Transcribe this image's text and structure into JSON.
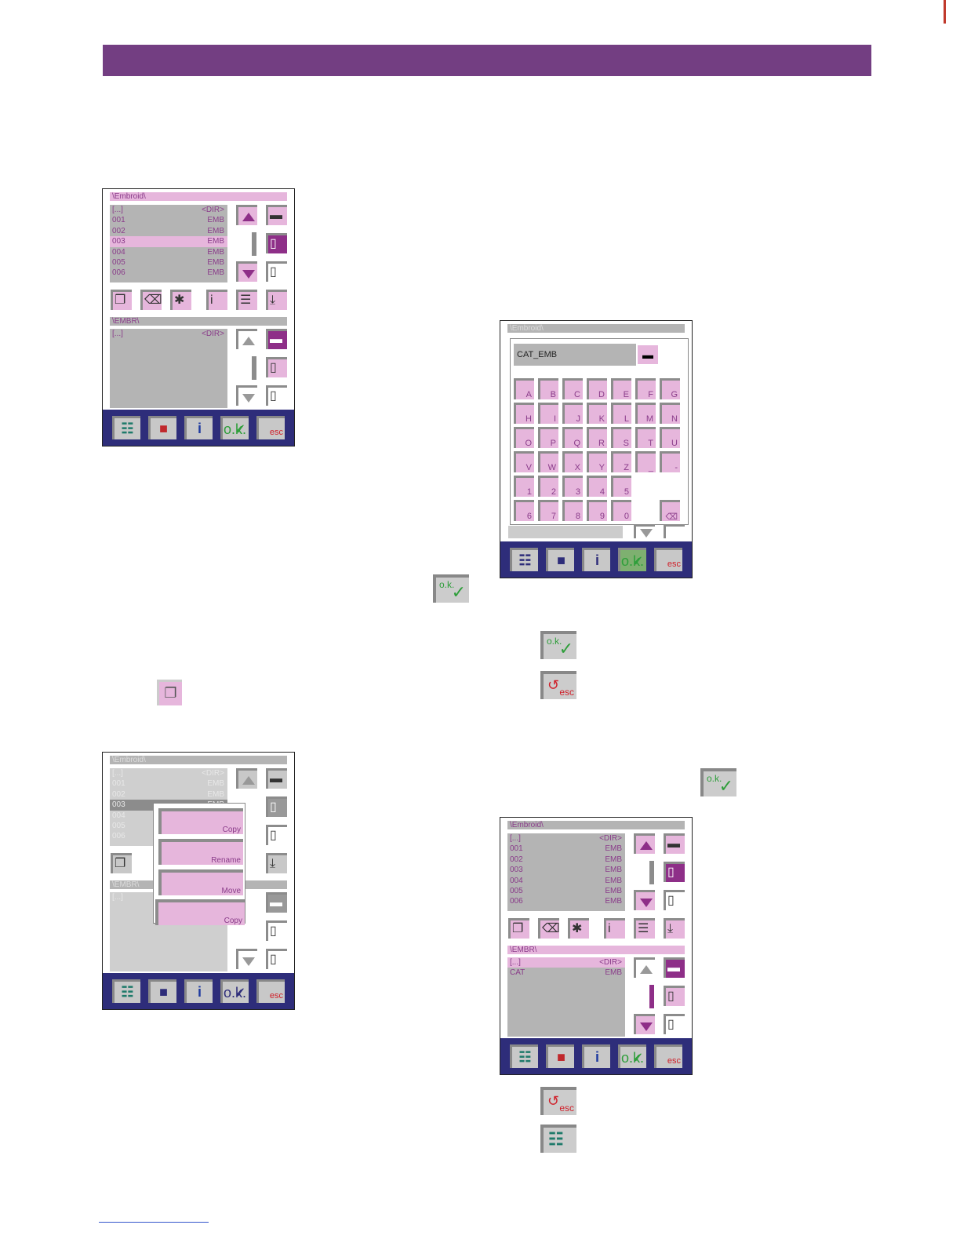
{
  "screen1": {
    "path_top": "\\Embroid\\",
    "files_top": [
      {
        "name": "[...]",
        "type": "<DIR>"
      },
      {
        "name": "001",
        "type": "EMB"
      },
      {
        "name": "002",
        "type": "EMB"
      },
      {
        "name": "003",
        "type": "EMB"
      },
      {
        "name": "004",
        "type": "EMB"
      },
      {
        "name": "005",
        "type": "EMB"
      },
      {
        "name": "006",
        "type": "EMB"
      }
    ],
    "path_bottom": "\\EMBR\\",
    "files_bottom": [
      {
        "name": "[...]",
        "type": "<DIR>"
      }
    ]
  },
  "screen2": {
    "path_top": "\\Embroid\\",
    "files_top": [
      {
        "name": "[...]",
        "type": "<DIR>"
      },
      {
        "name": "001",
        "type": "EMB"
      },
      {
        "name": "002",
        "type": "EMB"
      },
      {
        "name": "003",
        "type": "EMB"
      },
      {
        "name": "004",
        "type": "EMB"
      },
      {
        "name": "005",
        "type": "EMB"
      },
      {
        "name": "006",
        "type": "EMB"
      }
    ],
    "path_bottom": "\\EMBR\\",
    "files_bottom": [
      {
        "name": "[...]",
        "type": ""
      }
    ],
    "popup": [
      "Copy",
      "Rename",
      "Move",
      "Copy"
    ]
  },
  "screen3": {
    "path_top": "\\Embroid\\",
    "filename_value": "CAT_EMB",
    "keys": [
      [
        "A",
        "B",
        "C",
        "D",
        "E",
        "F",
        "G"
      ],
      [
        "H",
        "I",
        "J",
        "K",
        "L",
        "M",
        "N"
      ],
      [
        "O",
        "P",
        "Q",
        "R",
        "S",
        "T",
        "U"
      ],
      [
        "V",
        "W",
        "X",
        "Y",
        "Z",
        "_",
        "-"
      ],
      [
        "1",
        "2",
        "3",
        "4",
        "5"
      ],
      [
        "6",
        "7",
        "8",
        "9",
        "0"
      ]
    ]
  },
  "screen4": {
    "path_top": "\\Embroid\\",
    "files_top": [
      {
        "name": "[...]",
        "type": "<DIR>"
      },
      {
        "name": "001",
        "type": "EMB"
      },
      {
        "name": "002",
        "type": "EMB"
      },
      {
        "name": "003",
        "type": "EMB"
      },
      {
        "name": "004",
        "type": "EMB"
      },
      {
        "name": "005",
        "type": "EMB"
      },
      {
        "name": "006",
        "type": "EMB"
      }
    ],
    "path_bottom": "\\EMBR\\",
    "files_bottom": [
      {
        "name": "[...]",
        "type": "<DIR>"
      },
      {
        "name": "CAT",
        "type": "EMB"
      }
    ]
  },
  "bottom_bar": {
    "ok_label": "o.k.",
    "esc_label": "esc"
  },
  "icons": {
    "ok": "ok-check-icon",
    "esc": "esc-back-icon",
    "list": "file-list-icon",
    "copy": "copy-icon"
  },
  "colors": {
    "header": "#733e82",
    "pink": "#e6b6dc",
    "purple": "#8e2f88",
    "bar": "#2e2d7a"
  }
}
